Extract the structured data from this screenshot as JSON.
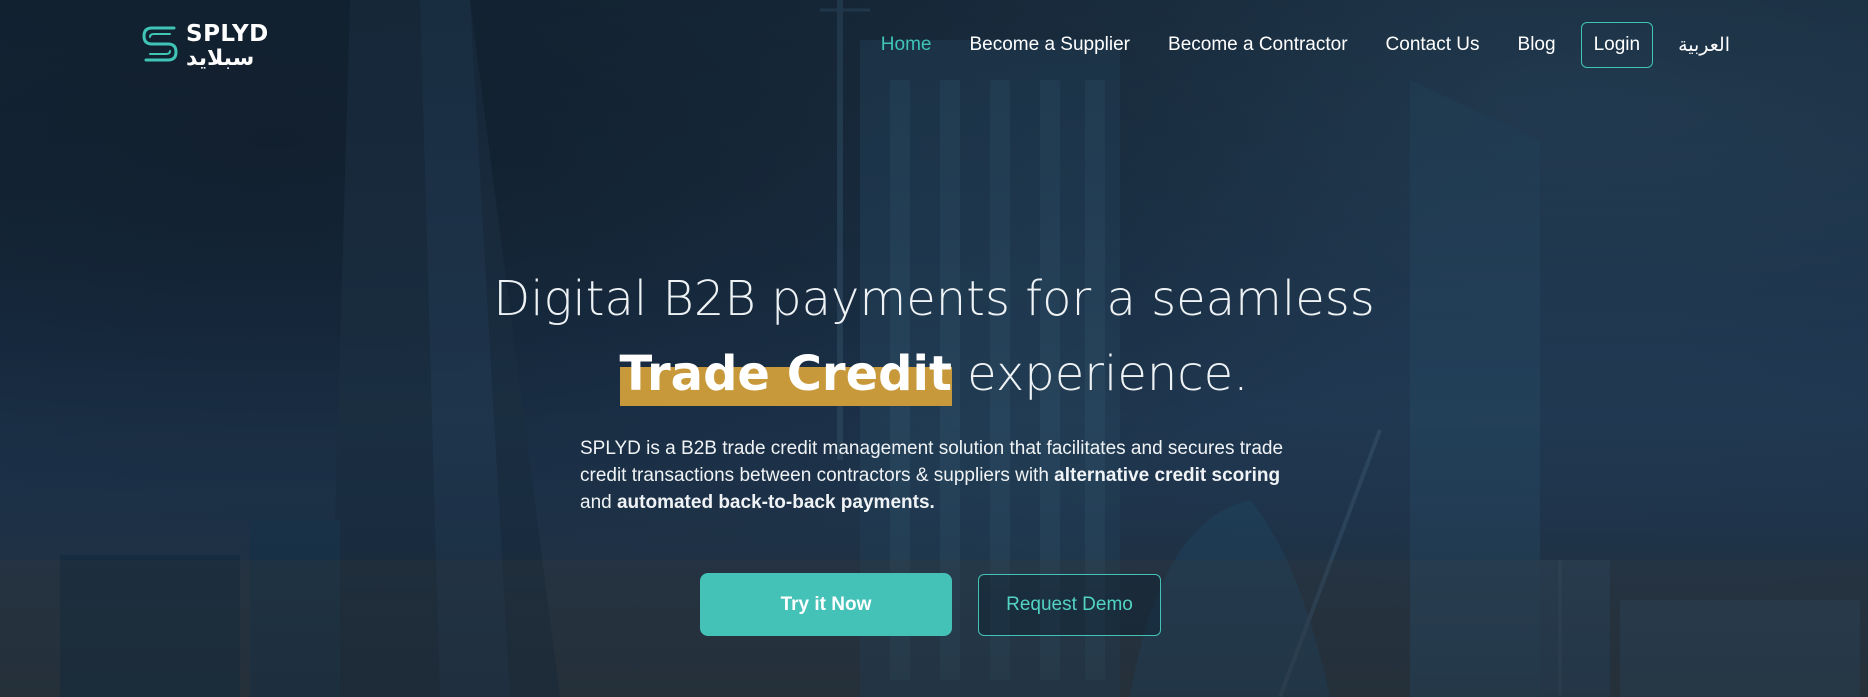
{
  "brand": {
    "name_en": "SPLYD",
    "name_ar": "سبلايد",
    "accent": "#3fc4b6",
    "highlight": "#c8993a"
  },
  "nav": {
    "items": [
      {
        "label": "Home",
        "active": true
      },
      {
        "label": "Become a Supplier",
        "active": false
      },
      {
        "label": "Become a Contractor",
        "active": false
      },
      {
        "label": "Contact Us",
        "active": false
      },
      {
        "label": "Blog",
        "active": false
      }
    ],
    "login": "Login",
    "language": "العربية"
  },
  "hero": {
    "headline_line1": "Digital B2B payments for a seamless",
    "headline_highlight": "Trade Credit",
    "headline_rest": " experience.",
    "desc_part1": "SPLYD is a B2B trade credit management solution that facilitates and secures trade credit transactions between contractors & suppliers with ",
    "desc_bold1": "alternative credit scoring",
    "desc_part2": " and ",
    "desc_bold2": "automated back-to-back payments.",
    "primary_cta": "Try it Now",
    "secondary_cta": "Request Demo"
  }
}
